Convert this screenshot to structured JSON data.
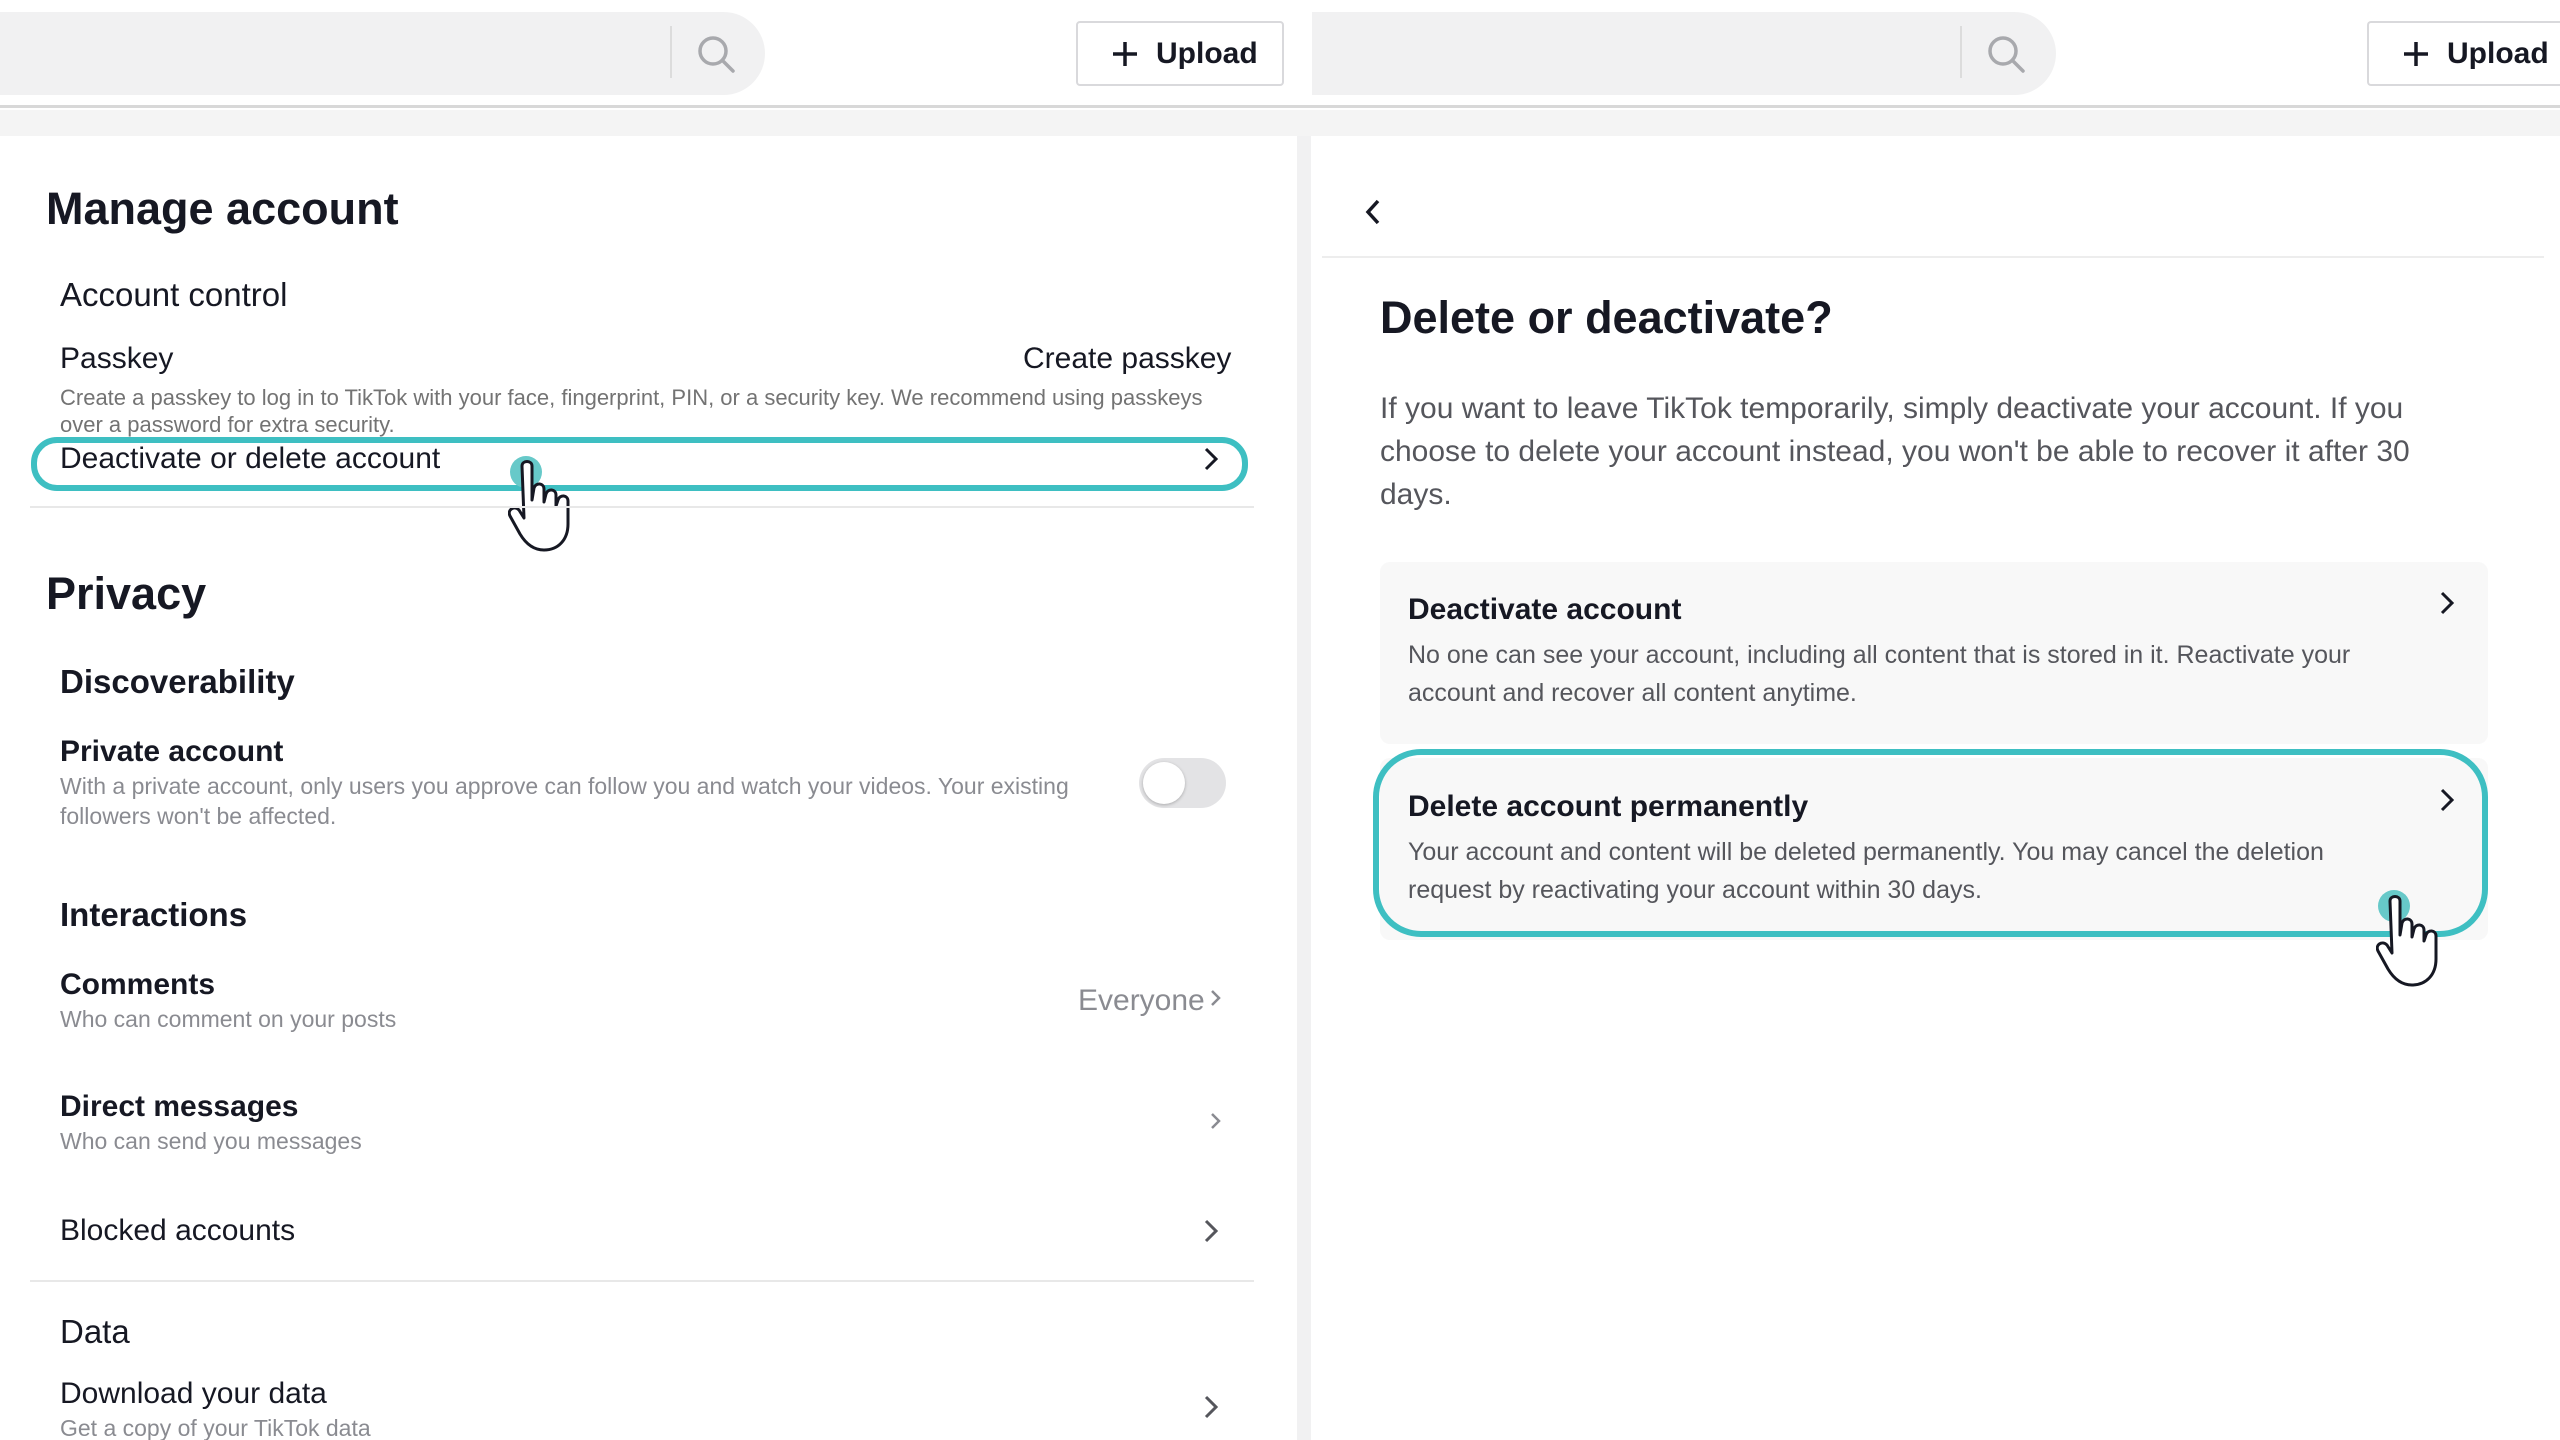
{
  "topbar": {
    "upload_label": "Upload",
    "upload_label_right": "Upload"
  },
  "manage": {
    "title": "Manage account",
    "account_control": "Account control",
    "passkey_label": "Passkey",
    "passkey_action": "Create passkey",
    "passkey_desc_line1": "Create a passkey to log in to TikTok with your face, fingerprint, PIN, or a security key. We recommend using passkeys",
    "passkey_desc_line2": "over a password for extra security.",
    "deactivate_label": "Deactivate or delete account"
  },
  "privacy": {
    "title": "Privacy",
    "discoverability": "Discoverability",
    "private_account_label": "Private account",
    "private_account_desc_line1": "With a private account, only users you approve can follow you and watch your videos. Your existing",
    "private_account_desc_line2": "followers won't be affected.",
    "private_account_on": false,
    "interactions": "Interactions",
    "comments_label": "Comments",
    "comments_desc": "Who can comment on your posts",
    "comments_value": "Everyone",
    "dm_label": "Direct messages",
    "dm_desc": "Who can send you messages",
    "blocked_label": "Blocked accounts"
  },
  "data_section": {
    "title": "Data",
    "download_label": "Download your data",
    "download_desc": "Get a copy of your TikTok data"
  },
  "delete_page": {
    "title": "Delete or deactivate?",
    "desc_line1": "If you want to leave TikTok temporarily, simply deactivate your account. If you",
    "desc_line2": "choose to delete your account instead, you won't be able to recover it after 30",
    "desc_line3": "days.",
    "deactivate_title": "Deactivate account",
    "deactivate_desc_line1": "No one can see your account, including all content that is stored in it. Reactivate your",
    "deactivate_desc_line2": "account and recover all content anytime.",
    "delete_title": "Delete account permanently",
    "delete_desc_line1": "Your account and content will be deleted permanently. You may cancel the deletion",
    "delete_desc_line2": "request by reactivating your account within 30 days."
  },
  "colors": {
    "highlight": "#3ebfc2",
    "text_primary": "#161823",
    "text_secondary": "#737373"
  }
}
